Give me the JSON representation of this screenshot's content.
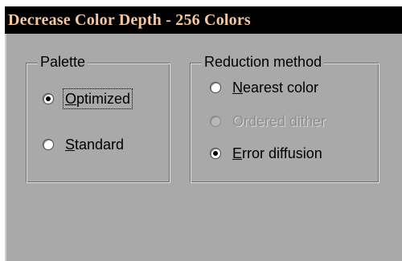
{
  "window": {
    "title": "Decrease Color Depth - 256 Colors"
  },
  "palette": {
    "label": "Palette",
    "options": [
      {
        "mnemonic": "O",
        "rest": "ptimized",
        "checked": true,
        "disabled": false,
        "focused": true
      },
      {
        "mnemonic": "S",
        "rest": "tandard",
        "checked": false,
        "disabled": false,
        "focused": false
      }
    ]
  },
  "reduction": {
    "label": "Reduction method",
    "options": [
      {
        "mnemonic": "N",
        "rest": "earest color",
        "checked": false,
        "disabled": false
      },
      {
        "mnemonic": "",
        "rest": "Ordered dither",
        "checked": false,
        "disabled": true
      },
      {
        "mnemonic": "E",
        "rest": "rror diffusion",
        "checked": true,
        "disabled": false
      }
    ]
  },
  "colors": {
    "dialog_bg": "#a9a9a9",
    "titlebar_bg": "#000000",
    "title_text": "#f3c79e",
    "disabled_text": "#8e8e8e"
  }
}
